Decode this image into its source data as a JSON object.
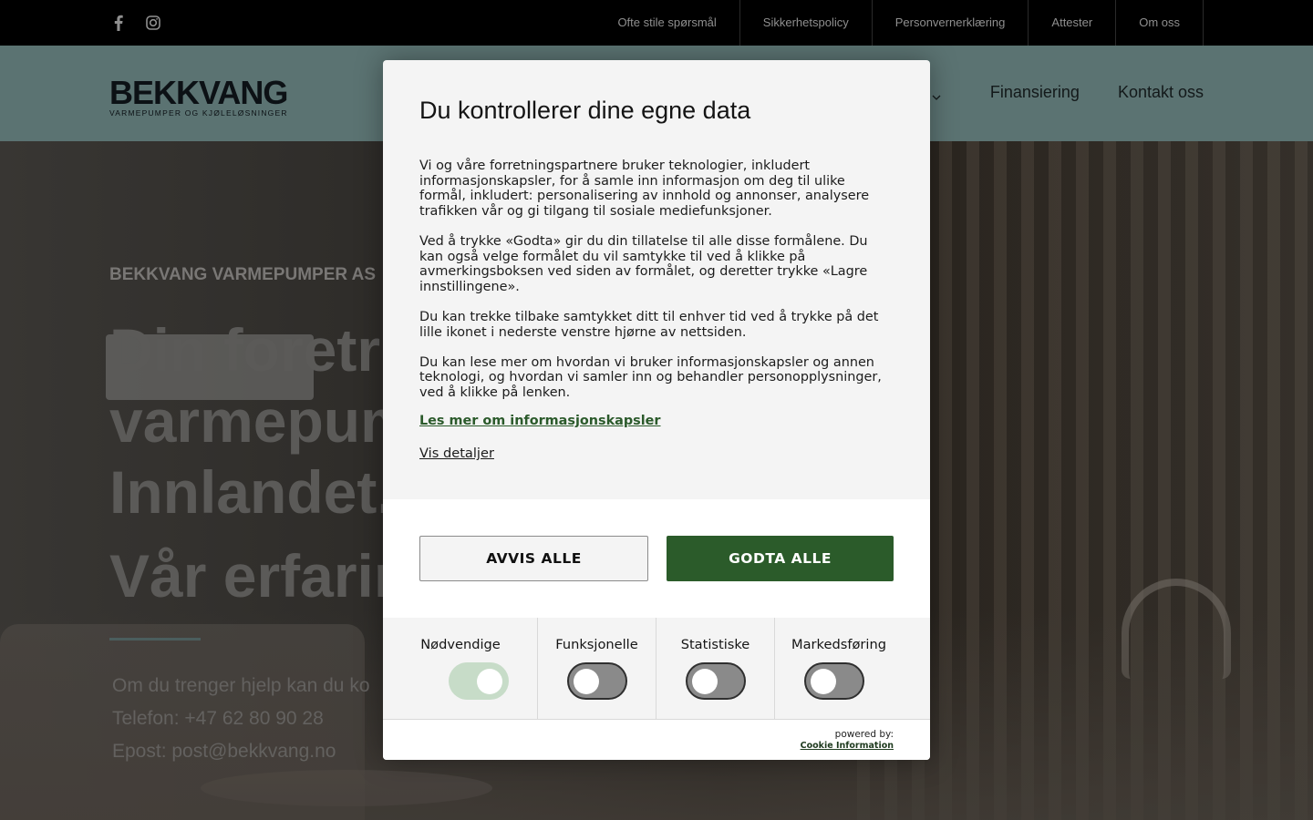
{
  "topbar": {
    "social": [
      "facebook-icon",
      "instagram-icon"
    ],
    "links": [
      "Ofte stile spørsmål",
      "Sikkerhetspolicy",
      "Personvernerklæring",
      "Attester",
      "Om oss"
    ]
  },
  "header": {
    "logo_text": "BEKKVANG",
    "logo_sub": "VARMEPUMPER OG KJØLELØSNINGER",
    "nav": [
      "Finansiering",
      "Kontakt oss"
    ],
    "colors": {
      "header_bg": "#5e7776",
      "topbar_bg": "#000000"
    }
  },
  "hero": {
    "eyebrow": "BEKKVANG VARMEPUMPER AS",
    "headline_lines": [
      "Din foretru",
      "varmepum",
      "Innlandet."
    ],
    "headline2": "Vår erfarin",
    "info_lines": [
      "Om du trenger hjelp kan du ko",
      "Telefon: +47 62 80 90 28",
      "Epost: post@bekkvang.no"
    ]
  },
  "modal": {
    "title": "Du kontrollerer dine egne data",
    "paragraphs": [
      "Vi og våre forretningspartnere bruker teknologier, inkludert informasjonskapsler, for å samle inn informasjon om deg til ulike formål, inkludert: personalisering av innhold og annonser, analysere trafikken vår og gi tilgang til sosiale mediefunksjoner.",
      "Ved å trykke «Godta» gir du din tillatelse til alle disse formålene. Du kan også velge formålet du vil samtykke til ved å klikke på avmerkingsboksen ved siden av formålet, og deretter trykke «Lagre innstillingene».",
      "Du kan trekke tilbake samtykket ditt til enhver tid ved å trykke på det lille ikonet i nederste venstre hjørne av nettsiden.",
      "Du kan lese mer om hvordan vi bruker informasjonskapsler og annen teknologi, og hvordan vi samler inn og behandler personopplysninger, ved å klikke på lenken."
    ],
    "read_more": "Les mer om informasjonskapsler",
    "details": "Vis detaljer",
    "reject_label": "AVVIS ALLE",
    "accept_label": "GODTA ALLE",
    "accent_color": "#2b5b2a",
    "toggles": [
      {
        "label": "Nødvendige",
        "on": true
      },
      {
        "label": "Funksjonelle",
        "on": false
      },
      {
        "label": "Statistiske",
        "on": false
      },
      {
        "label": "Markedsføring",
        "on": false
      }
    ],
    "powered_by": "powered by:",
    "powered_brand": "Cookie Information"
  }
}
